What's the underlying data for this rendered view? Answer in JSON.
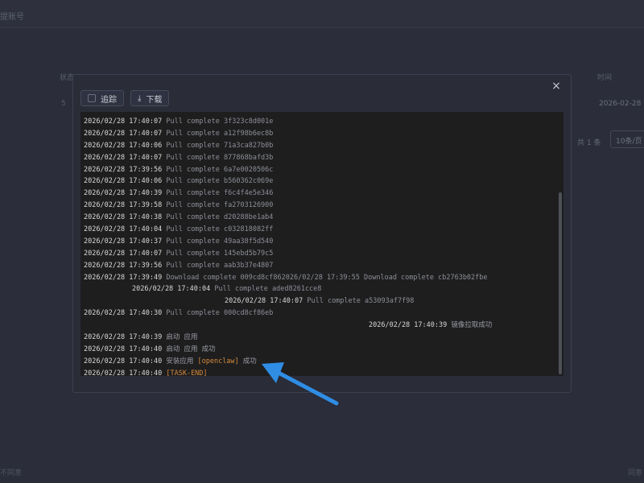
{
  "background": {
    "title": "提账号",
    "col_left": "状态",
    "col_right": "时间",
    "row_date": "2026-02-28 1",
    "row_stub": "5",
    "total": "共 1 条",
    "page_size": "10条/页",
    "footer_left": "不同意",
    "footer_right": "同意"
  },
  "modal": {
    "close_symbol": "×",
    "toolbar": {
      "follow_label": "追踪",
      "download_label": "下载"
    },
    "log": [
      {
        "ts": "2026/02/28 17:40:07",
        "msg": "Pull complete 3f323c8d001e",
        "indent": 0
      },
      {
        "ts": "2026/02/28 17:40:07",
        "msg": "Pull complete a12f98b6ec8b",
        "indent": 0
      },
      {
        "ts": "2026/02/28 17:40:06",
        "msg": "Pull complete 71a3ca827b0b",
        "indent": 0
      },
      {
        "ts": "2026/02/28 17:40:07",
        "msg": "Pull complete 877868bafd3b",
        "indent": 0
      },
      {
        "ts": "2026/02/28 17:39:56",
        "msg": "Pull complete 6a7e0020506c",
        "indent": 0
      },
      {
        "ts": "2026/02/28 17:40:06",
        "msg": "Pull complete b560362c069e",
        "indent": 0
      },
      {
        "ts": "2026/02/28 17:40:39",
        "msg": "Pull complete f6c4f4e5e346",
        "indent": 0
      },
      {
        "ts": "2026/02/28 17:39:58",
        "msg": "Pull complete fa2703126900",
        "indent": 0
      },
      {
        "ts": "2026/02/28 17:40:38",
        "msg": "Pull complete d20288be1ab4",
        "indent": 0
      },
      {
        "ts": "2026/02/28 17:40:04",
        "msg": "Pull complete c032818082ff",
        "indent": 0
      },
      {
        "ts": "2026/02/28 17:40:37",
        "msg": "Pull complete 49aa38f5d540",
        "indent": 0
      },
      {
        "ts": "2026/02/28 17:40:07",
        "msg": "Pull complete 145ebd5b79c5",
        "indent": 0
      },
      {
        "ts": "2026/02/28 17:39:56",
        "msg": "Pull complete aab3b37e4807",
        "indent": 0
      },
      {
        "ts": "2026/02/28 17:39:49",
        "msg": "Download complete 009cd8cf862026/02/28 17:39:55 Download complete cb2763b02fbe",
        "indent": 0
      },
      {
        "ts": "2026/02/28 17:40:04",
        "msg": "Pull complete aded8261cce8",
        "indent": 60
      },
      {
        "ts": "2026/02/28 17:40:07",
        "msg": "Pull complete a53093af7f98",
        "indent": 175
      },
      {
        "ts": "2026/02/28 17:40:30",
        "msg": "Pull complete 000cd8cf86eb",
        "indent": 0
      },
      {
        "ts": "2026/02/28 17:40:39",
        "msg": "镜像拉取成功",
        "indent": 354
      },
      {
        "ts": "2026/02/28 17:40:39",
        "msg": "启动 应用",
        "indent": 0
      },
      {
        "ts": "2026/02/28 17:40:40",
        "msg": "启动 应用 成功",
        "indent": 0
      },
      {
        "ts": "2026/02/28 17:40:40",
        "msg_pre": "安装应用 ",
        "tag": "[openclaw]",
        "msg_post": " 成功",
        "indent": 0
      },
      {
        "ts": "2026/02/28 17:40:40",
        "tag": "[TASK-END]",
        "indent": 0
      }
    ]
  },
  "colors": {
    "log_background": "#1e1e1f",
    "timestamp": "#d8d8d8",
    "message": "#8c8f96",
    "highlight_tag": "#d68a3c",
    "annotation_arrow": "#2f8de4"
  }
}
